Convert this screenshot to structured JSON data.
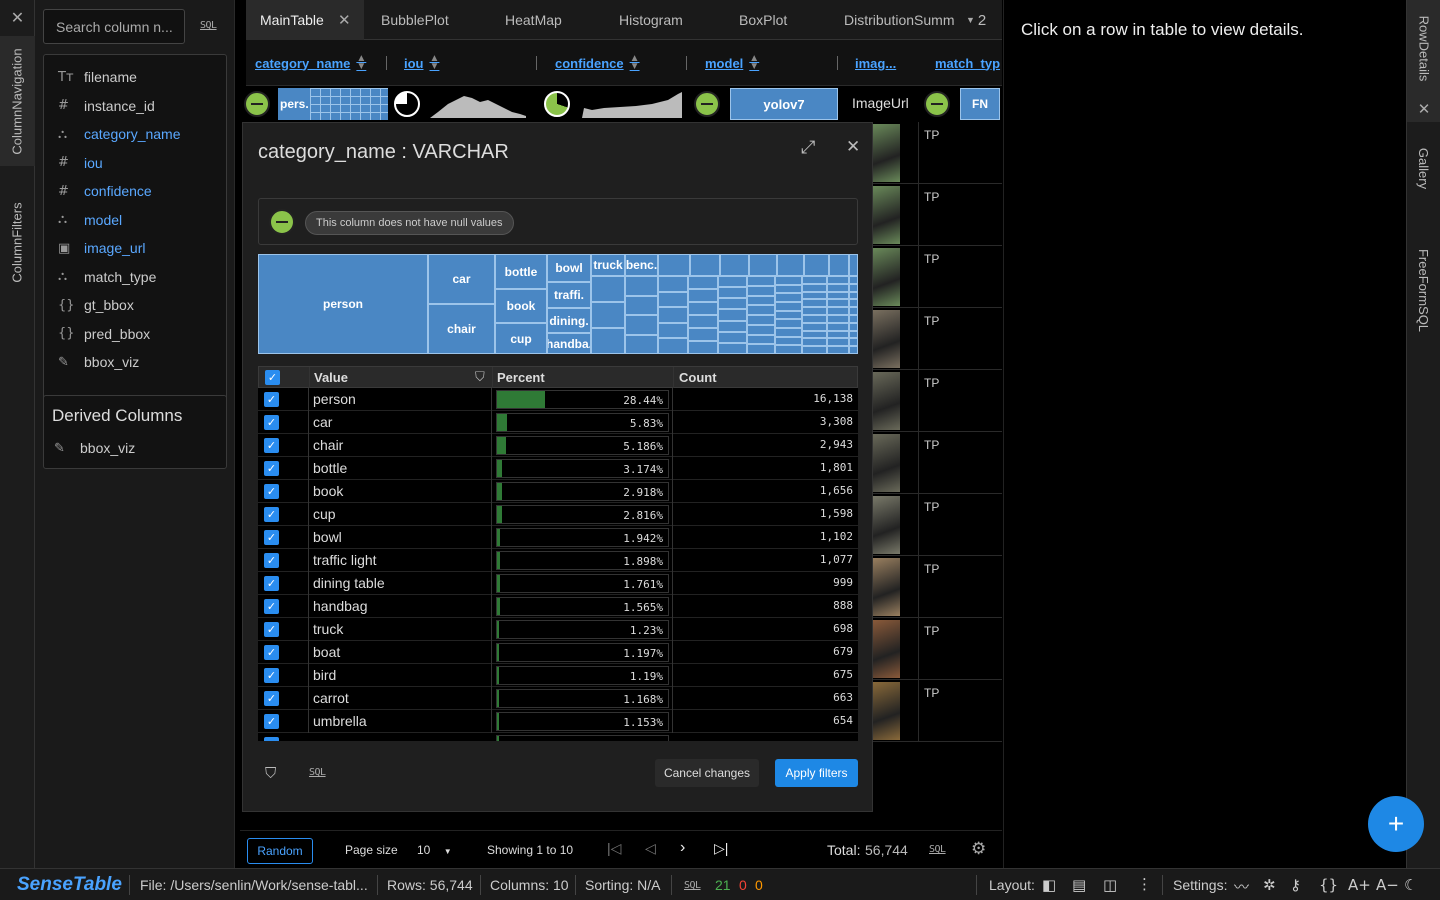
{
  "left_rail": {
    "tabs": [
      "ColumnNavigation",
      "ColumnFilters"
    ]
  },
  "column_nav": {
    "search_placeholder": "Search column n...",
    "sql_label": "SQL",
    "columns": [
      {
        "icon": "text-type-icon",
        "glyph": "Tт",
        "name": "filename",
        "highlight": false
      },
      {
        "icon": "number-type-icon",
        "glyph": "#",
        "name": "instance_id",
        "highlight": false
      },
      {
        "icon": "category-type-icon",
        "glyph": "⛬",
        "name": "category_name",
        "highlight": true
      },
      {
        "icon": "number-type-icon",
        "glyph": "#",
        "name": "iou",
        "highlight": true
      },
      {
        "icon": "number-type-icon",
        "glyph": "#",
        "name": "confidence",
        "highlight": true
      },
      {
        "icon": "category-type-icon",
        "glyph": "⛬",
        "name": "model",
        "highlight": true
      },
      {
        "icon": "image-type-icon",
        "glyph": "▣",
        "name": "image_url",
        "highlight": true
      },
      {
        "icon": "category-type-icon",
        "glyph": "⛬",
        "name": "match_type",
        "highlight": false
      },
      {
        "icon": "json-type-icon",
        "glyph": "{}",
        "name": "gt_bbox",
        "highlight": false
      },
      {
        "icon": "json-type-icon",
        "glyph": "{}",
        "name": "pred_bbox",
        "highlight": false
      },
      {
        "icon": "brush-icon",
        "glyph": "✎",
        "name": "bbox_viz",
        "highlight": false
      }
    ],
    "derived_title": "Derived Columns",
    "derived_columns": [
      "bbox_viz"
    ]
  },
  "tabs": {
    "items": [
      "MainTable",
      "BubblePlot",
      "HeatMap",
      "Histogram",
      "BoxPlot",
      "DistributionSumm"
    ],
    "overflow_count": "2"
  },
  "table_header": [
    "category_name",
    "iou",
    "confidence",
    "model",
    "imag...",
    "match_typ"
  ],
  "summary_row": {
    "category_label": "pers.",
    "model_label": "yolov7",
    "image_label": "ImageUrl",
    "match_label": "FN"
  },
  "background_rows": {
    "match_values": [
      "TP",
      "TP",
      "TP",
      "TP",
      "TP",
      "TP",
      "TP",
      "TP",
      "TP",
      "TP"
    ]
  },
  "modal": {
    "title": "category_name : VARCHAR",
    "null_message": "This column does not have null values",
    "treemap_labels": [
      "person",
      "car",
      "chair",
      "bottle",
      "book",
      "cup",
      "bowl",
      "traffi.",
      "dining.",
      "handba.",
      "truck",
      "benc."
    ],
    "table": {
      "headers": {
        "value": "Value",
        "percent": "Percent",
        "count": "Count"
      },
      "rows": [
        {
          "value": "person",
          "percent": "28.44%",
          "pct": 28.44,
          "count": "16,138"
        },
        {
          "value": "car",
          "percent": "5.83%",
          "pct": 5.83,
          "count": "3,308"
        },
        {
          "value": "chair",
          "percent": "5.186%",
          "pct": 5.186,
          "count": "2,943"
        },
        {
          "value": "bottle",
          "percent": "3.174%",
          "pct": 3.174,
          "count": "1,801"
        },
        {
          "value": "book",
          "percent": "2.918%",
          "pct": 2.918,
          "count": "1,656"
        },
        {
          "value": "cup",
          "percent": "2.816%",
          "pct": 2.816,
          "count": "1,598"
        },
        {
          "value": "bowl",
          "percent": "1.942%",
          "pct": 1.942,
          "count": "1,102"
        },
        {
          "value": "traffic light",
          "percent": "1.898%",
          "pct": 1.898,
          "count": "1,077"
        },
        {
          "value": "dining table",
          "percent": "1.761%",
          "pct": 1.761,
          "count": "999"
        },
        {
          "value": "handbag",
          "percent": "1.565%",
          "pct": 1.565,
          "count": "888"
        },
        {
          "value": "truck",
          "percent": "1.23%",
          "pct": 1.23,
          "count": "698"
        },
        {
          "value": "boat",
          "percent": "1.197%",
          "pct": 1.197,
          "count": "679"
        },
        {
          "value": "bird",
          "percent": "1.19%",
          "pct": 1.19,
          "count": "675"
        },
        {
          "value": "carrot",
          "percent": "1.168%",
          "pct": 1.168,
          "count": "663"
        },
        {
          "value": "umbrella",
          "percent": "1.153%",
          "pct": 1.153,
          "count": "654"
        }
      ]
    },
    "sql_label": "SQL",
    "cancel_label": "Cancel changes",
    "apply_label": "Apply filters"
  },
  "pager": {
    "random_label": "Random",
    "page_size_label": "Page size",
    "page_size_value": "10",
    "showing": "Showing 1 to 10",
    "total_label": "Total:",
    "total_value": "56,744",
    "sql_label": "SQL"
  },
  "right_panel": {
    "message": "Click on a row in table to view details."
  },
  "right_rail": {
    "tabs": [
      "RowDetails",
      "Gallery",
      "FreeFormSQL"
    ]
  },
  "status_bar": {
    "logo": "SenseTable",
    "file": "File: /Users/senlin/Work/sense-tabl...",
    "rows": "Rows: 56,744",
    "columns": "Columns: 10",
    "sorting": "Sorting: N/A",
    "sql_label": "SQL",
    "count_green": "21",
    "count_red": "0",
    "count_orange": "0",
    "layout_label": "Layout:",
    "settings_label": "Settings:"
  },
  "colors": {
    "accent": "#2a8df0",
    "link": "#4aa3ff",
    "treemap": "#4a87c4",
    "bar": "#2f7a36",
    "pie_green": "#8bc34a"
  }
}
